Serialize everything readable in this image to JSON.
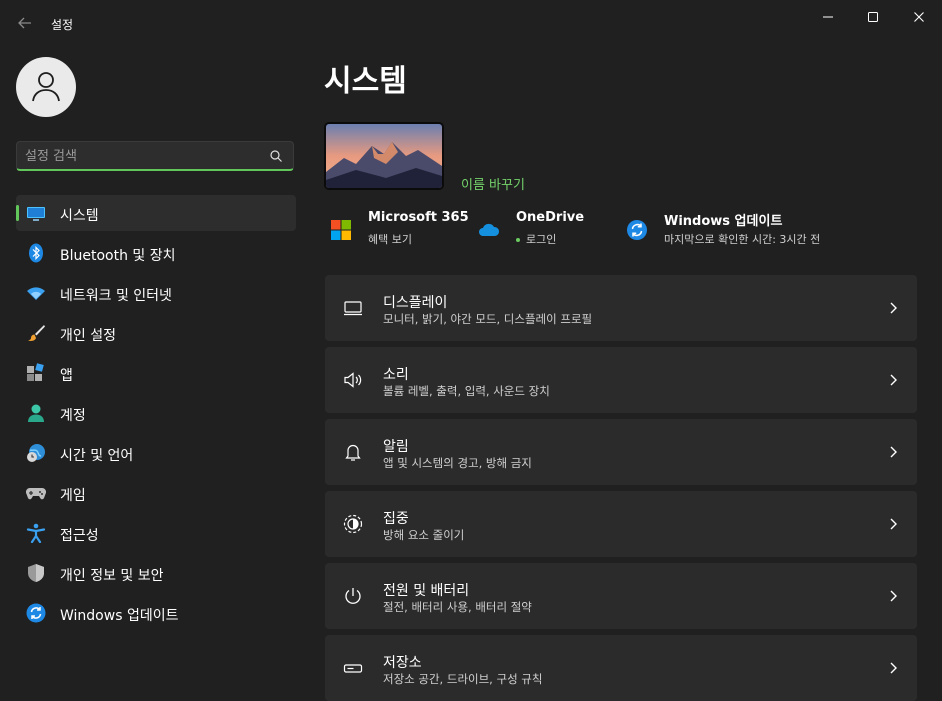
{
  "window": {
    "title": "설정"
  },
  "search": {
    "placeholder": "설정 검색"
  },
  "sidebar": {
    "items": [
      {
        "label": "시스템",
        "icon": "monitor-icon",
        "active": true
      },
      {
        "label": "Bluetooth 및 장치",
        "icon": "bluetooth-icon"
      },
      {
        "label": "네트워크 및 인터넷",
        "icon": "wifi-icon"
      },
      {
        "label": "개인 설정",
        "icon": "brush-icon"
      },
      {
        "label": "앱",
        "icon": "apps-icon"
      },
      {
        "label": "계정",
        "icon": "account-icon"
      },
      {
        "label": "시간 및 언어",
        "icon": "globe-clock-icon"
      },
      {
        "label": "게임",
        "icon": "gamepad-icon"
      },
      {
        "label": "접근성",
        "icon": "accessibility-icon"
      },
      {
        "label": "개인 정보 및 보안",
        "icon": "shield-icon"
      },
      {
        "label": "Windows 업데이트",
        "icon": "update-icon"
      }
    ]
  },
  "main": {
    "title": "시스템",
    "rename_label": "이름 바꾸기",
    "info": [
      {
        "title": "Microsoft 365",
        "subtitle": "혜택 보기",
        "icon": "microsoft-logo-icon"
      },
      {
        "title": "OneDrive",
        "subtitle": "로그인",
        "icon": "onedrive-cloud-icon"
      },
      {
        "title": "Windows 업데이트",
        "subtitle": "마지막으로 확인한 시간: 3시간 전",
        "icon": "update-icon"
      }
    ],
    "cards": [
      {
        "title": "디스플레이",
        "subtitle": "모니터, 밝기, 야간 모드, 디스플레이 프로필",
        "icon": "display-icon"
      },
      {
        "title": "소리",
        "subtitle": "볼륨 레벨, 출력, 입력, 사운드 장치",
        "icon": "speaker-icon"
      },
      {
        "title": "알림",
        "subtitle": "앱 및 시스템의 경고, 방해 금지",
        "icon": "bell-icon"
      },
      {
        "title": "집중",
        "subtitle": "방해 요소 줄이기",
        "icon": "focus-icon"
      },
      {
        "title": "전원 및 배터리",
        "subtitle": "절전, 배터리 사용, 배터리 절약",
        "icon": "power-icon"
      },
      {
        "title": "저장소",
        "subtitle": "저장소 공간, 드라이브, 구성 규칙",
        "icon": "storage-icon"
      }
    ]
  },
  "colors": {
    "accent": "#62c75a",
    "background": "#202020",
    "card": "#2b2b2b"
  }
}
